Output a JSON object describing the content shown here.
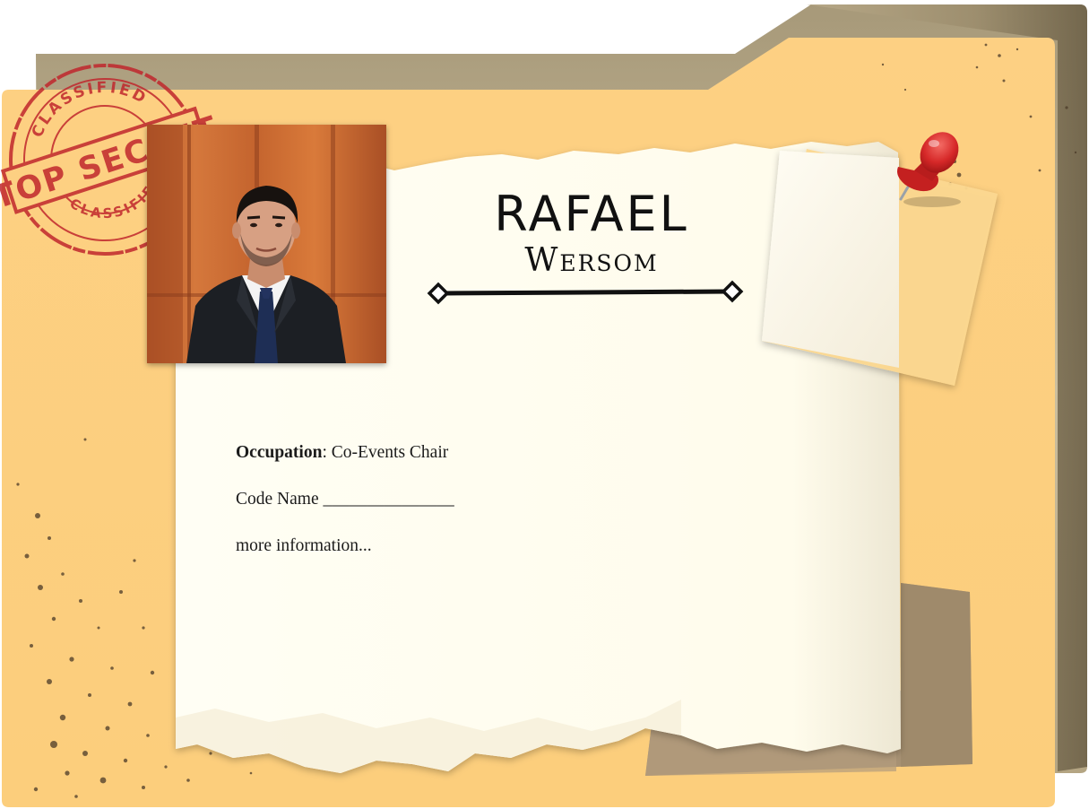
{
  "stamp": {
    "main": "TOP SECRET",
    "ring": "CLASSIFIED",
    "color": "#c0272d"
  },
  "profile": {
    "first_name": "RAFAEL",
    "last_name": "Wersom",
    "photo_alt": "Portrait photo"
  },
  "details": {
    "occupation_label": "Occupation",
    "occupation_value": ": Co-Events Chair",
    "code_name": "Code Name _______________",
    "more": "more information..."
  },
  "colors": {
    "folder": "#fdcf7b",
    "folder_back": "#b9ab8d",
    "paper": "#fffdf0",
    "pin": "#d92b2b",
    "kraft": "#a89275"
  }
}
